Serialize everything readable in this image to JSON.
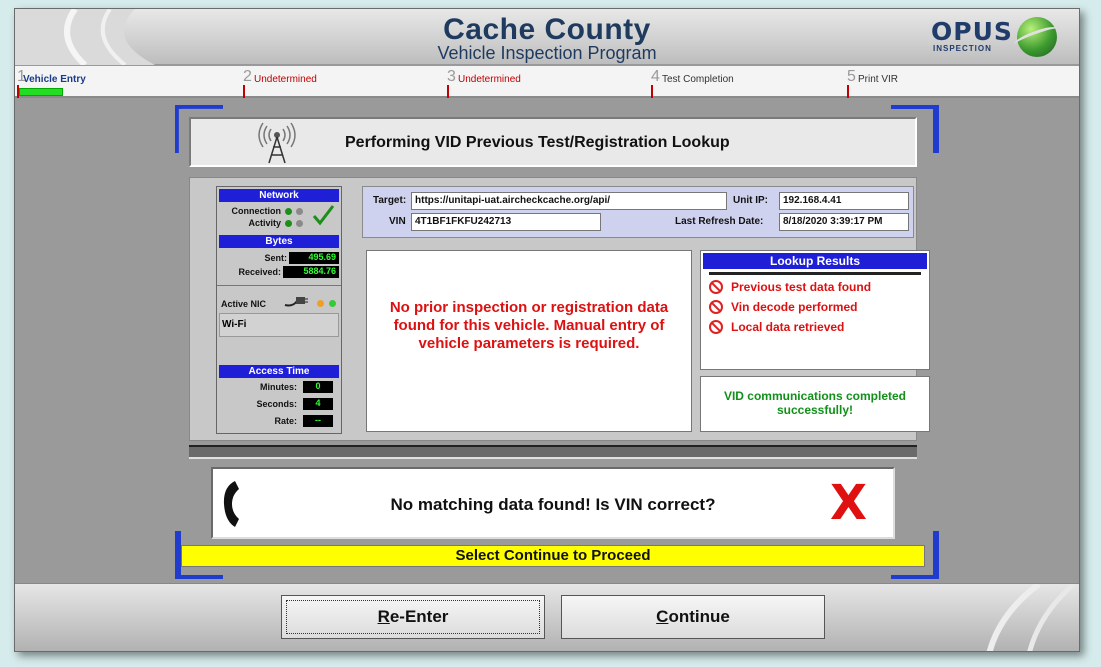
{
  "header": {
    "title": "Cache County",
    "subtitle": "Vehicle Inspection Program",
    "logo_text": "OPUS",
    "logo_sub": "INSPECTION"
  },
  "steps": [
    {
      "num": "1",
      "label": "Vehicle Entry",
      "state": "active"
    },
    {
      "num": "2",
      "label": "Undetermined",
      "state": "undetermined"
    },
    {
      "num": "3",
      "label": "Undetermined",
      "state": "undetermined"
    },
    {
      "num": "4",
      "label": "Test Completion",
      "state": "pending"
    },
    {
      "num": "5",
      "label": "Print VIR",
      "state": "pending"
    }
  ],
  "lookup": {
    "title": "Performing VID Previous Test/Registration Lookup"
  },
  "network": {
    "header": "Network",
    "connection_label": "Connection",
    "activity_label": "Activity",
    "bytes_header": "Bytes",
    "sent_label": "Sent:",
    "sent_value": "495.69",
    "received_label": "Received:",
    "received_value": "5884.76",
    "nic_label": "Active NIC",
    "nic_value": "Wi-Fi",
    "access_header": "Access Time",
    "minutes_label": "Minutes:",
    "minutes_value": "0",
    "seconds_label": "Seconds:",
    "seconds_value": "4",
    "rate_label": "Rate:",
    "rate_value": "--"
  },
  "connection": {
    "target_label": "Target:",
    "target_value": "https://unitapi-uat.aircheckcache.org/api/",
    "unit_ip_label": "Unit IP:",
    "unit_ip_value": "192.168.4.41",
    "vin_label": "VIN",
    "vin_value": "4T1BF1FKFU242713",
    "refresh_label": "Last Refresh Date:",
    "refresh_value": "8/18/2020 3:39:17 PM"
  },
  "message": "No prior inspection or registration data found for this vehicle. Manual entry of vehicle parameters is required.",
  "results": {
    "title": "Lookup Results",
    "items": [
      "Previous test data found",
      "Vin decode performed",
      "Local data retrieved"
    ]
  },
  "comm_status": "VID communications completed successfully!",
  "alert": "No matching data found! Is VIN correct?",
  "alert_mark": "X",
  "proceed": "Select Continue to Proceed",
  "buttons": {
    "reenter_u": "R",
    "reenter_rest": "e-Enter",
    "continue_u": "C",
    "continue_rest": "ontinue"
  },
  "colors": {
    "accent": "#1f1fd8",
    "error": "#dd1111",
    "success": "#11901a",
    "highlight": "#ffff00"
  }
}
